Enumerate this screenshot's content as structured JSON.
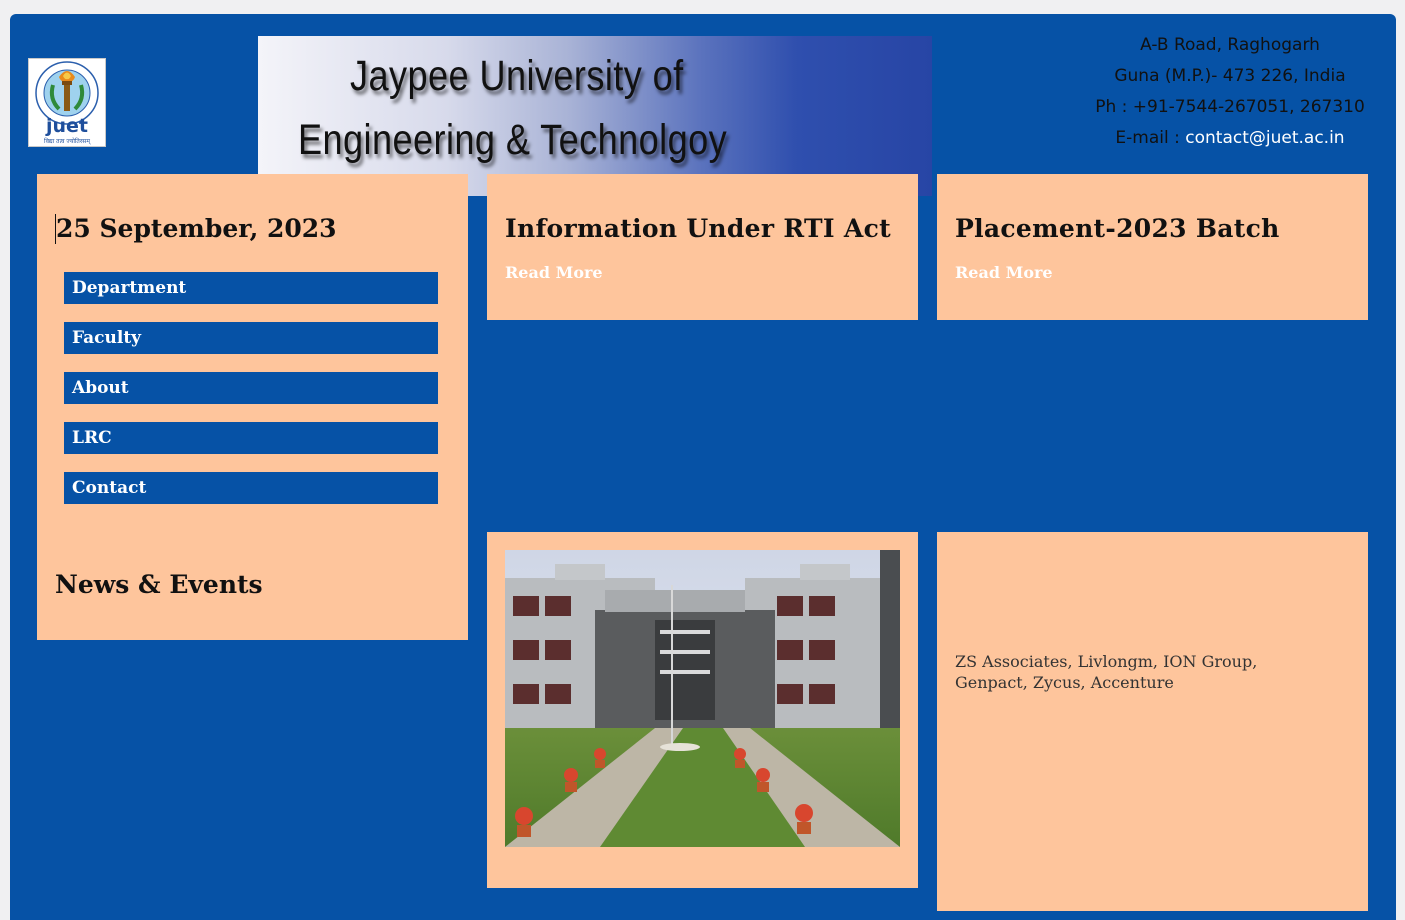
{
  "header": {
    "logo": {
      "text": "juet",
      "tagline": "विद्या तत्व ज्योतिरसम्",
      "ring_text": "JAYPEE UNIVERSITY OF ENGINEERING & TECHNOLOGY"
    },
    "banner": {
      "line1": "Jaypee University of",
      "line2": "Engineering & Technolgoy"
    },
    "address": {
      "line1": "A-B Road, Raghogarh",
      "line2": "Guna (M.P.)- 473 226, India",
      "phone": "Ph : +91-7544-267051, 267310",
      "email_label": "E-mail : ",
      "email": "contact@juet.ac.in"
    }
  },
  "sidebar": {
    "date": "25 September, 2023",
    "nav": [
      {
        "label": "Department"
      },
      {
        "label": "Faculty"
      },
      {
        "label": "About"
      },
      {
        "label": "LRC"
      },
      {
        "label": "Contact"
      }
    ],
    "news_title": "News & Events"
  },
  "cards": {
    "rti": {
      "title": "Information Under RTI Act",
      "link": "Read More"
    },
    "placement": {
      "title": "Placement-2023 Batch",
      "link": "Read More"
    }
  },
  "companies": {
    "text": "ZS Associates, Livlongm, ION Group, Genpact, Zycus, Accenture"
  },
  "colors": {
    "brand": "#0652a6",
    "panel": "#fec59c",
    "page_bg": "#f0f0f2"
  }
}
